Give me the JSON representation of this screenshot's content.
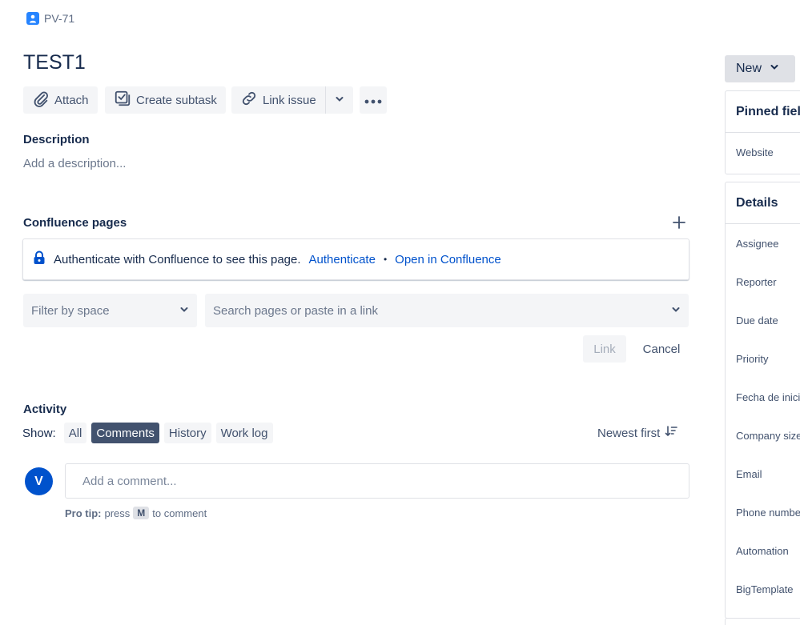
{
  "issue": {
    "key": "PV-71",
    "title": "TEST1"
  },
  "toolbar": {
    "attach": "Attach",
    "create_subtask": "Create subtask",
    "link_issue": "Link issue"
  },
  "description": {
    "label": "Description",
    "placeholder": "Add a description..."
  },
  "confluence": {
    "label": "Confluence pages",
    "message": "Authenticate with Confluence to see this page.",
    "authenticate": "Authenticate",
    "separator": "•",
    "open": "Open in Confluence",
    "filter_placeholder": "Filter by space",
    "search_placeholder": "Search pages or paste in a link",
    "link_button": "Link",
    "cancel_button": "Cancel"
  },
  "activity": {
    "label": "Activity",
    "show_label": "Show:",
    "filters": [
      "All",
      "Comments",
      "History",
      "Work log"
    ],
    "active_filter": "Comments",
    "sort_label": "Newest first",
    "avatar_initial": "V",
    "comment_placeholder": "Add a comment...",
    "protip_prefix": "Pro tip:",
    "protip_press": "press",
    "protip_key": "M",
    "protip_suffix": "to comment"
  },
  "sidebar": {
    "status": "New",
    "pinned_title": "Pinned fields",
    "pinned_fields": [
      "Website"
    ],
    "details_title": "Details",
    "detail_fields": [
      "Assignee",
      "Reporter",
      "Due date",
      "Priority",
      "Fecha de inicio",
      "Company size",
      "Email",
      "Phone number",
      "Automation",
      "BigTemplate"
    ]
  },
  "colors": {
    "accent": "#0052cc",
    "active_chip": "#42526e",
    "button_bg": "#f4f5f7"
  }
}
